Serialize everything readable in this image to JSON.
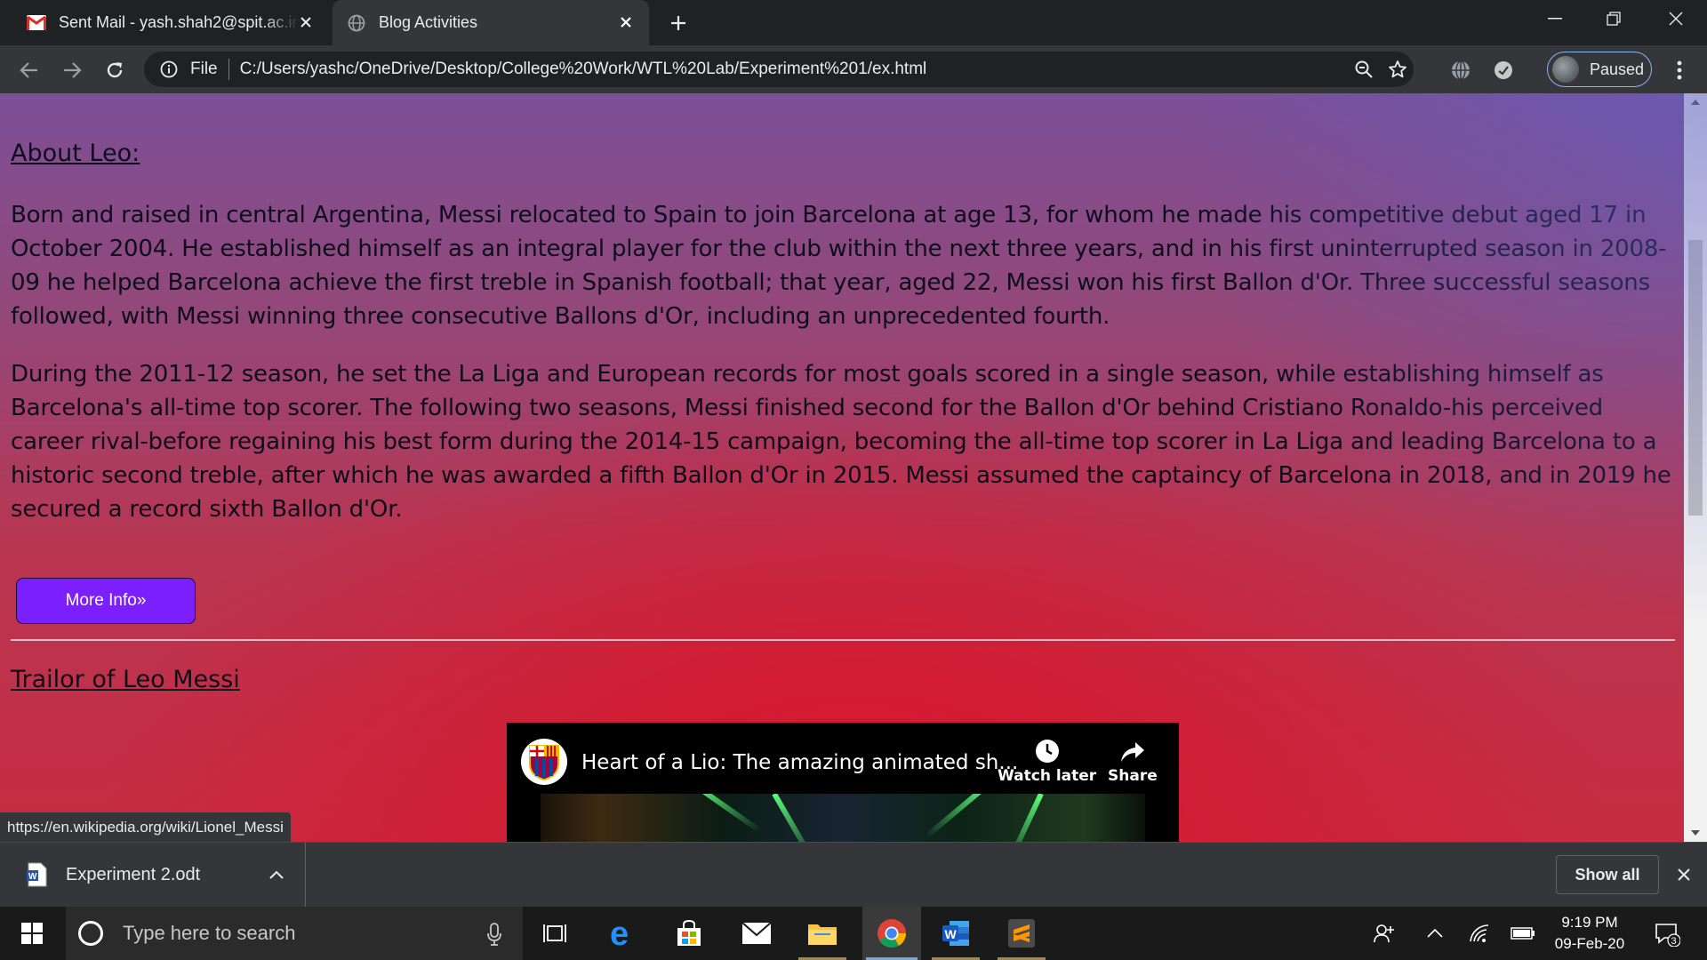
{
  "browser": {
    "tabs": [
      {
        "title": "Sent Mail - yash.shah2@spit.ac.in",
        "favicon": "gmail-icon"
      },
      {
        "title": "Blog Activities",
        "favicon": "globe-icon"
      }
    ],
    "address": {
      "scheme": "File",
      "url": "C:/Users/yashc/OneDrive/Desktop/College%20Work/WTL%20Lab/Experiment%201/ex.html"
    },
    "profile_label": "Paused"
  },
  "page": {
    "about_heading": "About Leo:",
    "para1": "Born and raised in central Argentina, Messi relocated to Spain to join Barcelona at age 13, for whom he made his competitive debut aged 17 in October 2004. He established himself as an integral player for the club within the next three years, and in his first uninterrupted season in 2008-09 he helped Barcelona achieve the first treble in Spanish football; that year, aged 22, Messi won his first Ballon d'Or. Three successful seasons followed, with Messi winning three consecutive Ballons d'Or, including an unprecedented fourth.",
    "para2": "During the 2011-12 season, he set the La Liga and European records for most goals scored in a single season, while establishing himself as Barcelona's all-time top scorer. The following two seasons, Messi finished second for the Ballon d'Or behind Cristiano Ronaldo-his perceived career rival-before regaining his best form during the 2014-15 campaign, becoming the all-time top scorer in La Liga and leading Barcelona to a historic second treble, after which he was awarded a fifth Ballon d'Or in 2015. Messi assumed the captaincy of Barcelona in 2018, and in 2019 he secured a record sixth Ballon d'Or.",
    "more_button": "More Info»",
    "trailer_heading": "Trailor of Leo Messi",
    "video": {
      "title": "Heart of a Lio: The amazing animated sh...",
      "watch_later": "Watch later",
      "share": "Share"
    },
    "status_url": "https://en.wikipedia.org/wiki/Lionel_Messi"
  },
  "downloads": {
    "file_name": "Experiment 2.odt",
    "show_all": "Show all"
  },
  "taskbar": {
    "search_placeholder": "Type here to search",
    "time": "9:19 PM",
    "date": "09-Feb-20",
    "notification_count": "3"
  },
  "colors": {
    "more_button": "#7c1fff",
    "page_accent_red": "#d5182f",
    "page_accent_purple": "#7c4f97"
  }
}
